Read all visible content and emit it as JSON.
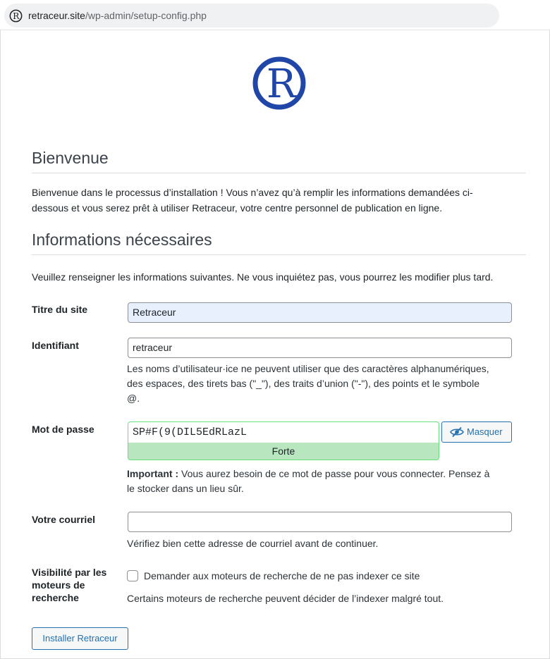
{
  "browser": {
    "url_host": "retraceur.site",
    "url_path": "/wp-admin/setup-config.php"
  },
  "brand": {
    "logo_icon": "retraceur-logo-icon",
    "color": "#2046a8"
  },
  "welcome": {
    "heading": "Bienvenue",
    "text_line1": "Bienvenue dans le processus d’installation ! Vous n’avez qu’à remplir les informations demandées ci-",
    "text_line2": "dessous et vous serez prêt à utiliser Retraceur, votre centre personnel de publication en ligne."
  },
  "info": {
    "heading": "Informations nécessaires",
    "intro": "Veuillez renseigner les informations suivantes. Ne vous inquiétez pas, vous pourrez les modifier plus tard."
  },
  "form": {
    "site_title": {
      "label": "Titre du site",
      "value": "Retraceur"
    },
    "username": {
      "label": "Identifiant",
      "value": "retraceur",
      "help_line1": "Les noms d’utilisateur·ice ne peuvent utiliser que des caractères alphanumériques,",
      "help_line2": "des espaces, des tirets bas (\"_\"), des traits d’union (\"-\"), des points et le symbole",
      "help_line3": "@."
    },
    "password": {
      "label": "Mot de passe",
      "value": "SP#F(9(DIL5EdRLazL",
      "strength": "Forte",
      "hide_button": "Masquer",
      "hide_icon": "eye-slash-icon",
      "important_bold": "Important :",
      "important_line1": " Vous aurez besoin de ce mot de passe pour vous connecter. Pensez à",
      "important_line2": "le stocker dans un lieu sûr."
    },
    "email": {
      "label": "Votre courriel",
      "value": "",
      "help": "Vérifiez bien cette adresse de courriel avant de continuer."
    },
    "visibility": {
      "label_line1": "Visibilité par les",
      "label_line2": "moteurs de",
      "label_line3": "recherche",
      "checkbox_label": "Demander aux moteurs de recherche de ne pas indexer ce site",
      "checked": false,
      "help": "Certains moteurs de recherche peuvent décider de l’indexer malgré tout."
    },
    "submit": "Installer Retraceur"
  }
}
